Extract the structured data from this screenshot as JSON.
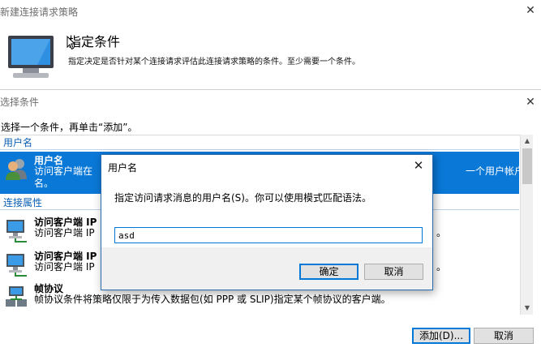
{
  "outer": {
    "title": "新建连接请求策略",
    "heading": "指定条件",
    "description": "指定决定是否针对某个连接请求评估此连接请求策略的条件。至少需要一个条件。"
  },
  "select_dialog": {
    "title": "选择条件",
    "instruction": "选择一个条件，再单击“添加”。",
    "groups": [
      {
        "header": "用户名",
        "items": [
          {
            "name": "用户名",
            "desc_line1": "访问客户端在",
            "desc_tail": "一个用户帐户",
            "desc_line2": "名。",
            "selected": true,
            "icon": "users-icon"
          }
        ]
      },
      {
        "header": "连接属性",
        "items": [
          {
            "name": "访问客户端 IP",
            "desc_line1": "访问客户端 IP",
            "desc_tail": "。",
            "icon": "computer-network-icon"
          },
          {
            "name": "访问客户端 IP",
            "desc_line1": "访问客户端 IP",
            "desc_tail": "。",
            "icon": "computer-network-icon"
          },
          {
            "name": "帧协议",
            "desc_line1": "帧协议条件将策略仅限于为传入数据包(如 PPP 或 SLIP)指定某个帧协议的客户端。",
            "icon": "frame-protocol-icon"
          }
        ]
      }
    ],
    "add_button": "添加(D)...",
    "cancel_button": "取消"
  },
  "modal": {
    "title": "用户名",
    "prompt": "指定访问请求消息的用户名(S)。你可以使用模式匹配语法。",
    "input_value": "asd",
    "ok_button": "确定",
    "cancel_button": "取消"
  },
  "colors": {
    "selection": "#0a78d7",
    "group_header": "#0a5fb4",
    "accent_border": "#0078d7"
  }
}
